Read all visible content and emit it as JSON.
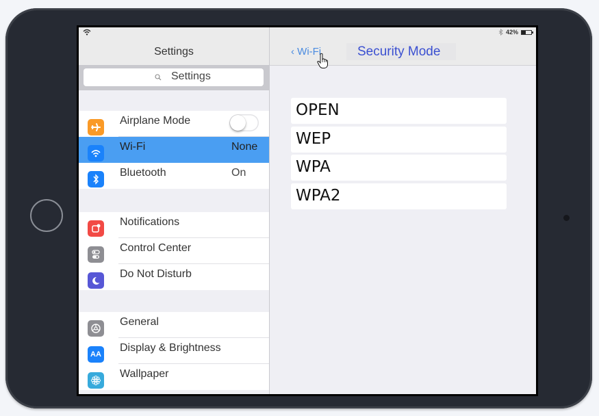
{
  "sidebar": {
    "title": "Settings",
    "search": {
      "placeholder": "Settings"
    },
    "groups": [
      {
        "items": [
          {
            "label": "Airplane Mode",
            "icon": "airplane-icon",
            "icon_color": "#fa9a27",
            "control": "toggle",
            "toggle_on": false
          },
          {
            "label": "Wi-Fi",
            "icon": "wifi-icon",
            "icon_color": "#1a82fb",
            "value": "None",
            "selected": true
          },
          {
            "label": "Bluetooth",
            "icon": "bluetooth-icon",
            "icon_color": "#1a82fb",
            "value": "On"
          }
        ]
      },
      {
        "items": [
          {
            "label": "Notifications",
            "icon": "notifications-icon",
            "icon_color": "#f24a45"
          },
          {
            "label": "Control Center",
            "icon": "control-center-icon",
            "icon_color": "#8e8e93"
          },
          {
            "label": "Do Not Disturb",
            "icon": "moon-icon",
            "icon_color": "#5757d6"
          }
        ]
      },
      {
        "items": [
          {
            "label": "General",
            "icon": "gear-icon",
            "icon_color": "#8e8e93"
          },
          {
            "label": "Display & Brightness",
            "icon": "display-brightness-icon",
            "icon_color": "#1a82fb",
            "icon_text": "AA"
          },
          {
            "label": "Wallpaper",
            "icon": "wallpaper-icon",
            "icon_color": "#37aadc"
          }
        ]
      }
    ]
  },
  "status": {
    "battery": "42%",
    "battery_level": 0.42
  },
  "detail": {
    "back_label": "‹ Wi-Fi",
    "title": "Security Mode",
    "modes": [
      "OPEN",
      "WEP",
      "WPA",
      "WPA2"
    ]
  }
}
